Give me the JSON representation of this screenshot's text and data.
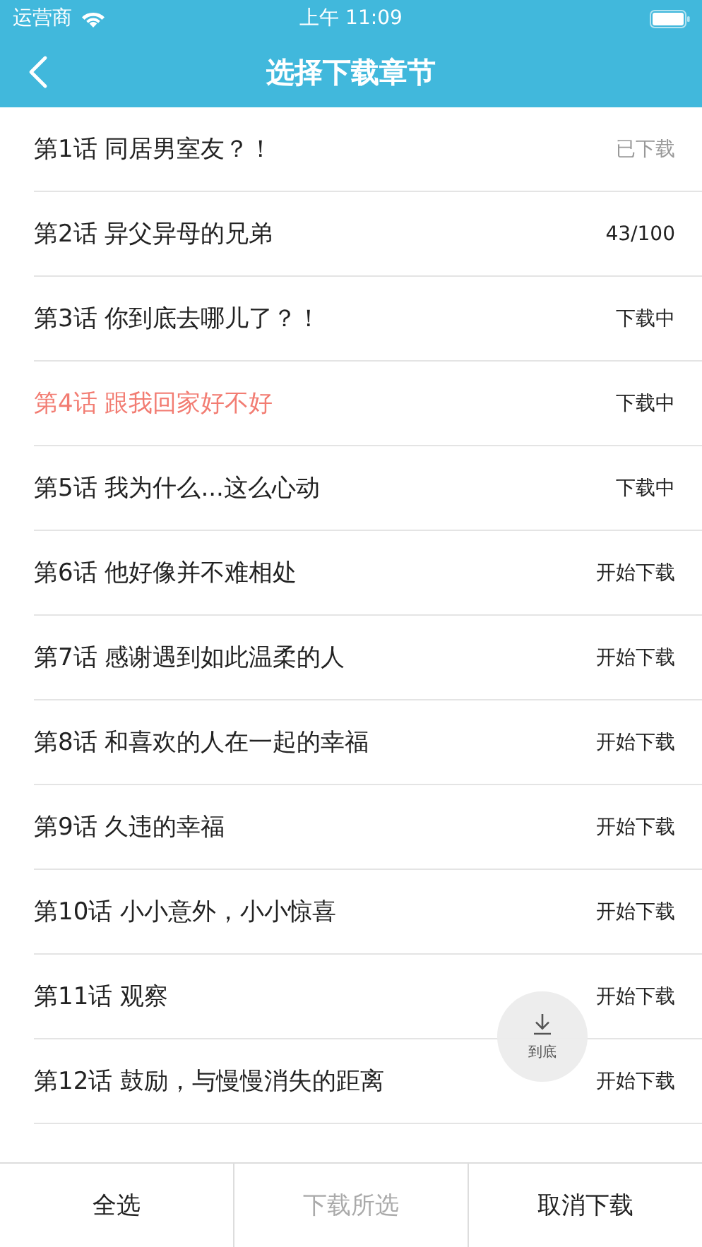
{
  "status_bar": {
    "carrier": "运营商",
    "time": "上午 11:09"
  },
  "nav": {
    "title": "选择下载章节"
  },
  "chapters": [
    {
      "title": "第1话 同居男室友？！",
      "status": "已下载",
      "kind": "downloaded",
      "highlighted": false
    },
    {
      "title": "第2话 异父异母的兄弟",
      "status": "43/100",
      "kind": "progress",
      "highlighted": false
    },
    {
      "title": "第3话 你到底去哪儿了？！",
      "status": "下载中",
      "kind": "downloading",
      "highlighted": false
    },
    {
      "title": "第4话 跟我回家好不好",
      "status": "下载中",
      "kind": "downloading",
      "highlighted": true
    },
    {
      "title": "第5话 我为什么...这么心动",
      "status": "下载中",
      "kind": "downloading",
      "highlighted": false
    },
    {
      "title": "第6话 他好像并不难相处",
      "status": "开始下载",
      "kind": "start",
      "highlighted": false
    },
    {
      "title": "第7话 感谢遇到如此温柔的人",
      "status": "开始下载",
      "kind": "start",
      "highlighted": false
    },
    {
      "title": "第8话 和喜欢的人在一起的幸福",
      "status": "开始下载",
      "kind": "start",
      "highlighted": false
    },
    {
      "title": "第9话 久违的幸福",
      "status": "开始下载",
      "kind": "start",
      "highlighted": false
    },
    {
      "title": "第10话 小小意外，小小惊喜",
      "status": "开始下载",
      "kind": "start",
      "highlighted": false
    },
    {
      "title": "第11话 观察",
      "status": "开始下载",
      "kind": "start",
      "highlighted": false
    },
    {
      "title": "第12话 鼓励，与慢慢消失的距离",
      "status": "开始下载",
      "kind": "start",
      "highlighted": false
    }
  ],
  "scroll_bottom_button": {
    "label": "到底"
  },
  "bottom_bar": [
    {
      "label": "全选",
      "disabled": false
    },
    {
      "label": "下载所选",
      "disabled": true
    },
    {
      "label": "取消下载",
      "disabled": false
    }
  ]
}
